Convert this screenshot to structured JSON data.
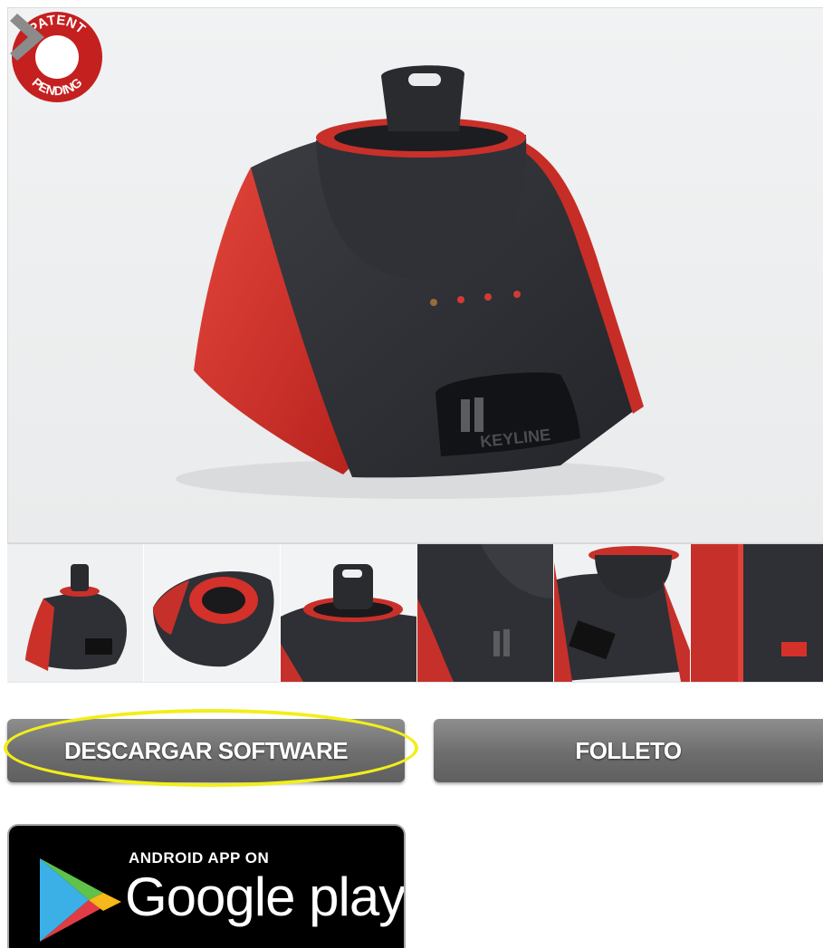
{
  "gallery": {
    "badge": {
      "top_text": "PATENT",
      "bottom_text": "PENDING"
    },
    "product_logo_text": "KEYLINE",
    "next_icon": "chevron-right-icon",
    "thumbnails": [
      {
        "name": "thumbnail-front-view"
      },
      {
        "name": "thumbnail-top-view"
      },
      {
        "name": "thumbnail-key-closeup"
      },
      {
        "name": "thumbnail-side-logo"
      },
      {
        "name": "thumbnail-angle-view"
      },
      {
        "name": "thumbnail-connector-view"
      }
    ]
  },
  "actions": {
    "download_label": "DESCARGAR SOFTWARE",
    "brochure_label": "FOLLETO"
  },
  "google_play": {
    "small_label": "ANDROID APP ON",
    "big_label": "Google play"
  },
  "colors": {
    "accent_red": "#d4312b",
    "body_dark": "#2b2d31",
    "button_gray": "#6d6d6d",
    "highlight": "#f2ee1a"
  }
}
